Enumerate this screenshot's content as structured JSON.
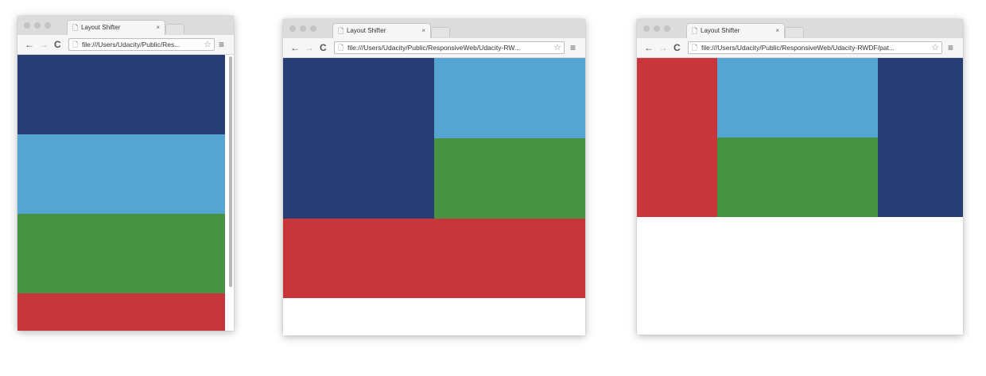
{
  "colors": {
    "dark_blue": "#283d73",
    "light_blue": "#55a5d2",
    "green": "#489343",
    "red": "#c7363b"
  },
  "windows": [
    {
      "tab_title": "Layout Shifter",
      "tab_close": "×",
      "url": "file:///Users/Udacity/Public/Res..."
    },
    {
      "tab_title": "Layout Shifter",
      "tab_close": "×",
      "url": "file:///Users/Udacity/Public/ResponsiveWeb/Udacity-RW..."
    },
    {
      "tab_title": "Layout Shifter",
      "tab_close": "×",
      "url": "file:///Users/Udacity/Public/ResponsiveWeb/Udacity-RWDF/pat..."
    }
  ],
  "icons": {
    "back": "←",
    "forward": "→",
    "reload": "C",
    "page": "🗋",
    "star": "☆",
    "menu": "≡"
  }
}
